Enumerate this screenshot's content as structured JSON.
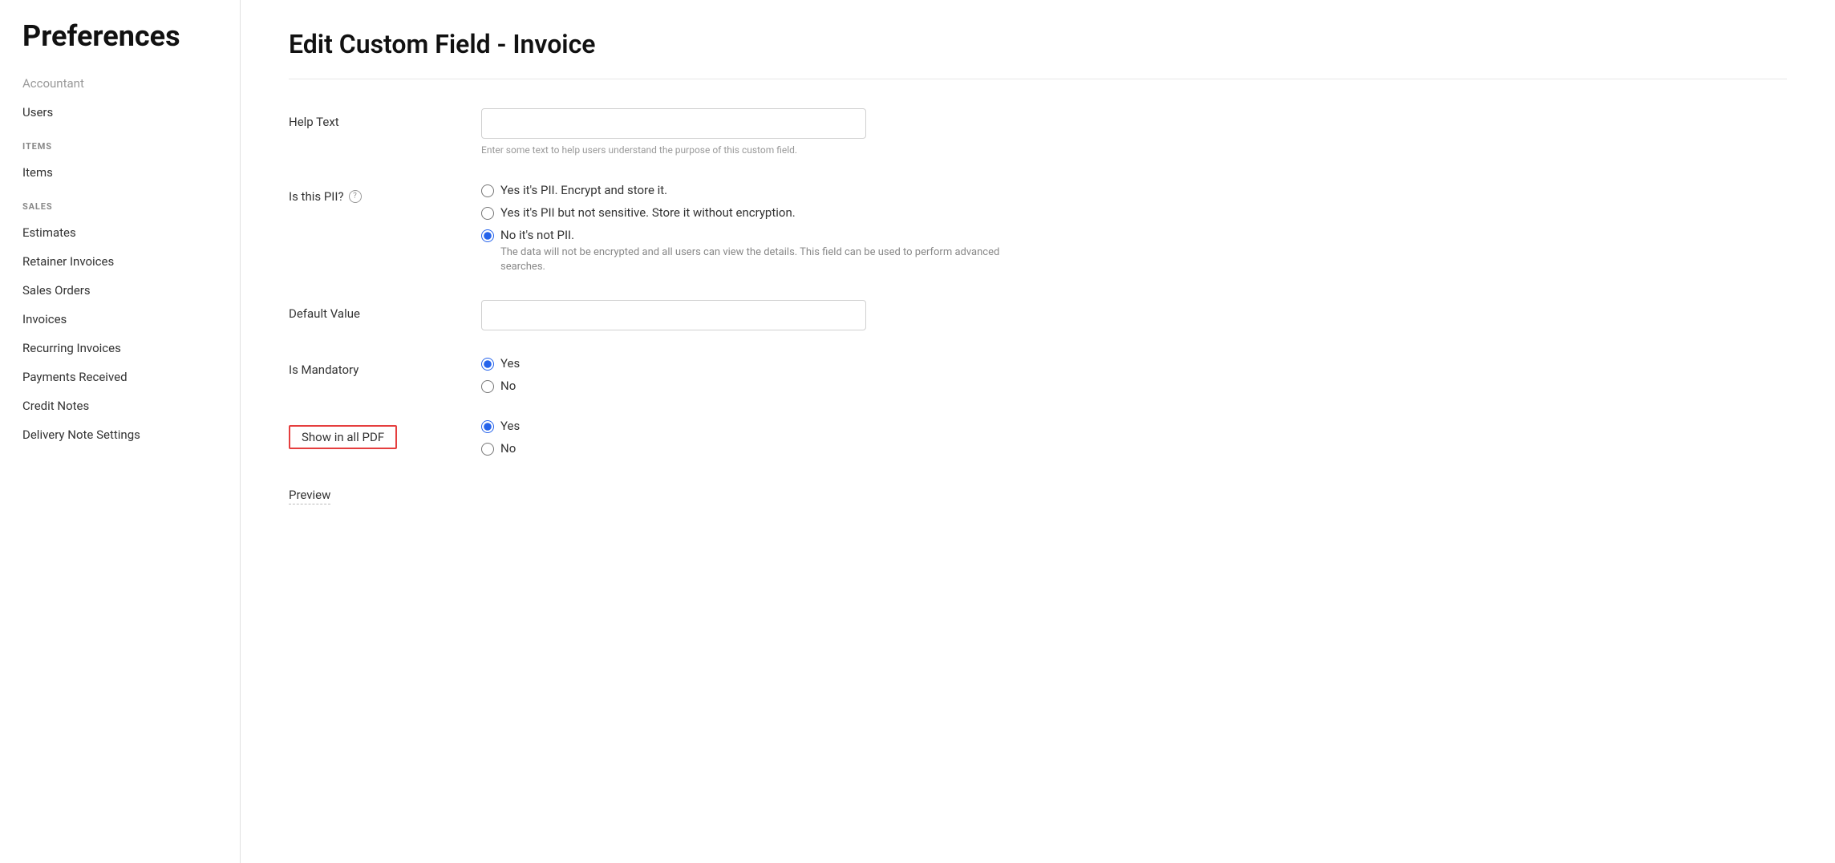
{
  "sidebar": {
    "title": "Preferences",
    "faded_item": "Accountant",
    "sections": [
      {
        "items": [
          {
            "label": "Users"
          }
        ]
      },
      {
        "section_label": "ITEMS",
        "items": [
          {
            "label": "Items"
          }
        ]
      },
      {
        "section_label": "SALES",
        "items": [
          {
            "label": "Estimates"
          },
          {
            "label": "Retainer Invoices"
          },
          {
            "label": "Sales Orders"
          },
          {
            "label": "Invoices"
          },
          {
            "label": "Recurring Invoices"
          },
          {
            "label": "Payments Received"
          },
          {
            "label": "Credit Notes"
          },
          {
            "label": "Delivery Note Settings"
          }
        ]
      }
    ]
  },
  "main": {
    "page_title": "Edit Custom Field - Invoice",
    "form": {
      "help_text": {
        "label": "Help Text",
        "placeholder": "",
        "hint": "Enter some text to help users understand the purpose of this custom field."
      },
      "is_pii": {
        "label": "Is this PII?",
        "options": [
          {
            "value": "encrypt",
            "label": "Yes it's PII. Encrypt and store it.",
            "checked": false
          },
          {
            "value": "not_sensitive",
            "label": "Yes it's PII but not sensitive. Store it without encryption.",
            "checked": false
          },
          {
            "value": "not_pii",
            "label": "No it's not PII.",
            "checked": true
          }
        ],
        "sub_text": "The data will not be encrypted and all users can view the details. This field can be used to perform advanced searches."
      },
      "default_value": {
        "label": "Default Value",
        "placeholder": ""
      },
      "is_mandatory": {
        "label": "Is Mandatory",
        "options": [
          {
            "value": "yes",
            "label": "Yes",
            "checked": true
          },
          {
            "value": "no",
            "label": "No",
            "checked": false
          }
        ]
      },
      "show_in_pdf": {
        "label": "Show in all PDF",
        "options": [
          {
            "value": "yes",
            "label": "Yes",
            "checked": true
          },
          {
            "value": "no",
            "label": "No",
            "checked": false
          }
        ]
      },
      "preview": {
        "label": "Preview"
      }
    }
  }
}
